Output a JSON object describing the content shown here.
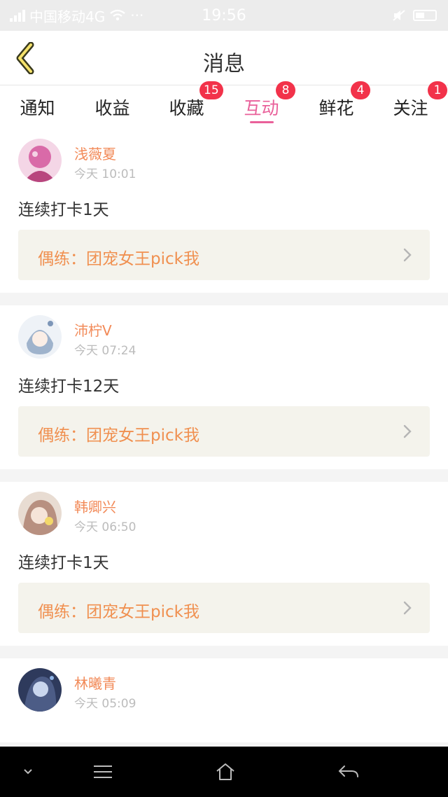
{
  "status_bar": {
    "carrier": "中国移动4G",
    "time": "19:56"
  },
  "header": {
    "title": "消息"
  },
  "tabs": [
    {
      "label": "通知",
      "badge": ""
    },
    {
      "label": "收益",
      "badge": ""
    },
    {
      "label": "收藏",
      "badge": "15"
    },
    {
      "label": "互动",
      "badge": "8",
      "active": true
    },
    {
      "label": "鲜花",
      "badge": "4"
    },
    {
      "label": "关注",
      "badge": "1"
    }
  ],
  "messages": [
    {
      "name": "浅薇夏",
      "time": "今天 10:01",
      "content": "连续打卡1天",
      "link": "偶练：团宠女王pick我",
      "avatar_color": "#d96aa8"
    },
    {
      "name": "沛柠V",
      "time": "今天 07:24",
      "content": "连续打卡12天",
      "link": "偶练：团宠女王pick我",
      "avatar_color": "#9fb3cc"
    },
    {
      "name": "韩卿兴",
      "time": "今天 06:50",
      "content": "连续打卡1天",
      "link": "偶练：团宠女王pick我",
      "avatar_color": "#b89080"
    },
    {
      "name": "林曦青",
      "time": "今天 05:09",
      "avatar_color": "#4c5c86"
    }
  ],
  "colors": {
    "accent": "#e9609a",
    "name": "#f28a58",
    "badge": "#f2324a",
    "link_bg": "#f4f3ec"
  }
}
